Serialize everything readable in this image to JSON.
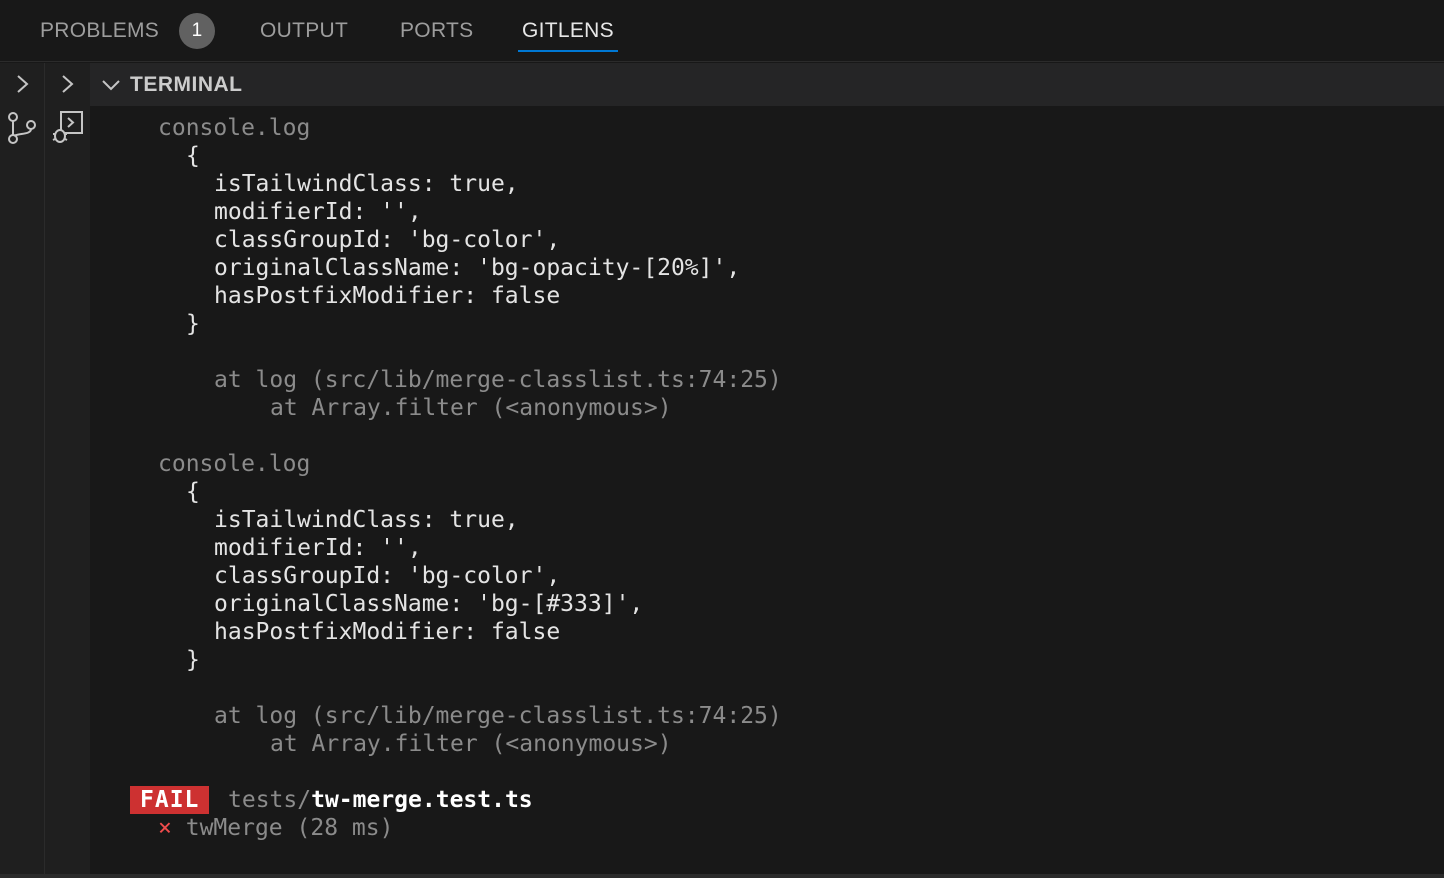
{
  "tabs": [
    {
      "label": "PROBLEMS",
      "badge": "1"
    },
    {
      "label": "OUTPUT"
    },
    {
      "label": "PORTS"
    },
    {
      "label": "GITLENS"
    }
  ],
  "active_tab": "GITLENS",
  "panel": {
    "title": "TERMINAL"
  },
  "terminal": {
    "blocks": [
      {
        "header": "console.log",
        "open": "{",
        "props": [
          "isTailwindClass: true,",
          "modifierId: '',",
          "classGroupId: 'bg-color',",
          "originalClassName: 'bg-opacity-[20%]',",
          "hasPostfixModifier: false"
        ],
        "close": "}",
        "trace1": "at log (src/lib/merge-classlist.ts:74:25)",
        "trace2": "at Array.filter (<anonymous>)"
      },
      {
        "header": "console.log",
        "open": "{",
        "props": [
          "isTailwindClass: true,",
          "modifierId: '',",
          "classGroupId: 'bg-color',",
          "originalClassName: 'bg-[#333]',",
          "hasPostfixModifier: false"
        ],
        "close": "}",
        "trace1": "at log (src/lib/merge-classlist.ts:74:25)",
        "trace2": "at Array.filter (<anonymous>)"
      }
    ],
    "result": {
      "status": "FAIL",
      "dir": "tests/",
      "file": "tw-merge.test.ts",
      "test_mark": "×",
      "test_name": "twMerge (28 ms)"
    }
  },
  "colors": {
    "accent": "#0078d4",
    "fail": "#cd3131",
    "error_x": "#f14c4c"
  }
}
